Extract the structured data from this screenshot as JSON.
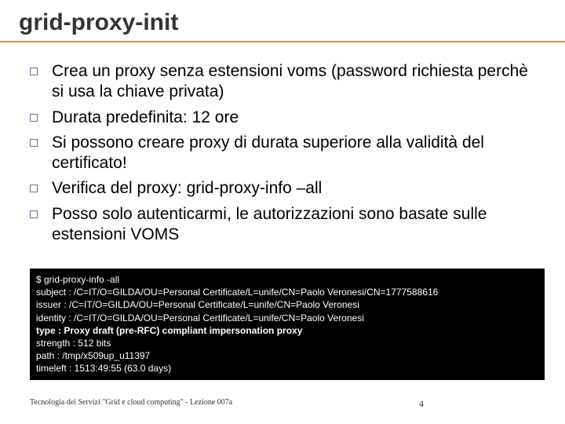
{
  "title": "grid-proxy-init",
  "bullets": [
    "Crea un proxy senza estensioni voms (password richiesta perchè si usa la chiave privata)",
    "Durata predefinita: 12 ore",
    "Si possono creare proxy di durata superiore alla validità del certificato!",
    "Verifica del proxy: grid-proxy-info –all",
    "Posso solo autenticarmi, le autorizzazioni sono basate sulle estensioni VOMS"
  ],
  "terminal": {
    "lines": [
      "$ grid-proxy-info -all",
      "subject  : /C=IT/O=GILDA/OU=Personal Certificate/L=unife/CN=Paolo Veronesi/CN=1777588616",
      "issuer   : /C=IT/O=GILDA/OU=Personal Certificate/L=unife/CN=Paolo Veronesi",
      "identity : /C=IT/O=GILDA/OU=Personal Certificate/L=unife/CN=Paolo Veronesi"
    ],
    "bold_line": "type     : Proxy draft (pre-RFC) compliant impersonation proxy",
    "lines2": [
      "strength : 512 bits",
      "path     : /tmp/x509up_u11397",
      "timeleft : 1513:49:55  (63.0 days)"
    ]
  },
  "footer": {
    "left": "Tecnologia dei Servizi \"Grid e cloud computing\" - Lezione 007a",
    "page": "4"
  }
}
